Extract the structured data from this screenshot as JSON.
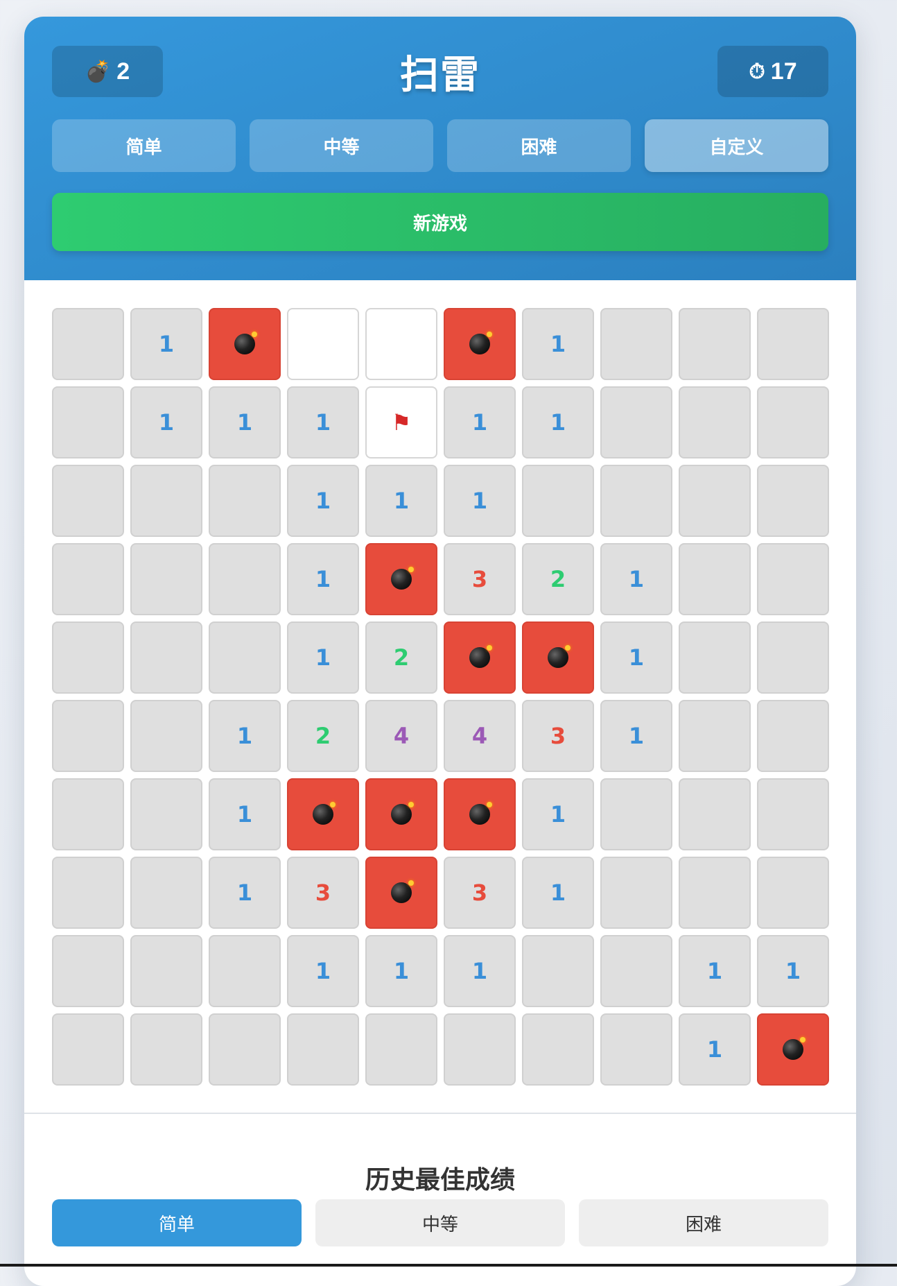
{
  "header": {
    "title": "扫雷",
    "mines_left": "2",
    "timer": "17"
  },
  "difficulty": {
    "options": [
      "简单",
      "中等",
      "困难",
      "自定义"
    ],
    "selected": "自定义"
  },
  "new_game_label": "新游戏",
  "board": {
    "rows": 10,
    "cols": 10,
    "cells": [
      [
        "r",
        "1",
        "m",
        "u",
        "u",
        "m",
        "1",
        "r",
        "r",
        "r"
      ],
      [
        "r",
        "1",
        "1",
        "1",
        "f",
        "1",
        "1",
        "r",
        "r",
        "r"
      ],
      [
        "r",
        "r",
        "r",
        "1",
        "1",
        "1",
        "r",
        "r",
        "r",
        "r"
      ],
      [
        "r",
        "r",
        "r",
        "1",
        "m",
        "3",
        "2",
        "1",
        "r",
        "r"
      ],
      [
        "r",
        "r",
        "r",
        "1",
        "2",
        "m",
        "m",
        "1",
        "r",
        "r"
      ],
      [
        "r",
        "r",
        "1",
        "2",
        "4",
        "4",
        "3",
        "1",
        "r",
        "r"
      ],
      [
        "r",
        "r",
        "1",
        "m",
        "m",
        "m",
        "1",
        "r",
        "r",
        "r"
      ],
      [
        "r",
        "r",
        "1",
        "3",
        "m",
        "3",
        "1",
        "r",
        "r",
        "r"
      ],
      [
        "r",
        "r",
        "r",
        "1",
        "1",
        "1",
        "r",
        "r",
        "1",
        "1"
      ],
      [
        "r",
        "r",
        "r",
        "r",
        "r",
        "r",
        "r",
        "r",
        "1",
        "m"
      ]
    ]
  },
  "best_scores": {
    "title": "历史最佳成绩",
    "tabs": [
      "简单",
      "中等",
      "困难"
    ],
    "active_tab": "简单"
  },
  "icons": {
    "mines_counter": "bomb-icon",
    "timer": "stopwatch-icon",
    "mine": "bomb-icon",
    "flag": "flag-icon"
  },
  "colors": {
    "header": "#3598dc",
    "new_game": "#2ecc71",
    "mine_cell": "#e74c3c",
    "num1": "#3a8fd8",
    "num2": "#2ecc71",
    "num3": "#e74c3c",
    "num4": "#9b59b6"
  }
}
